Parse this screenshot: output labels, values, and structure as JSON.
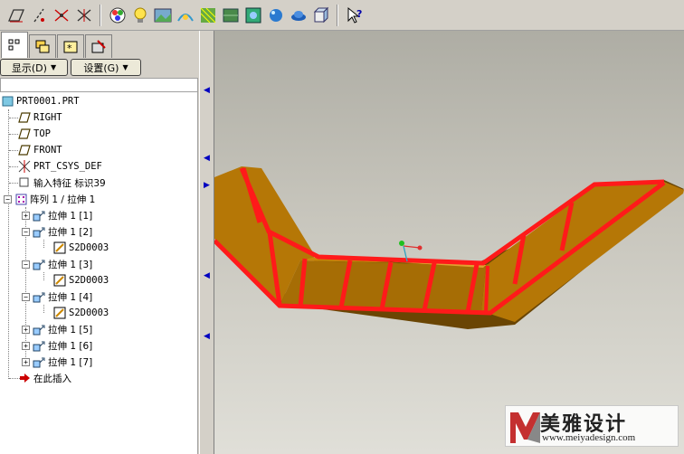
{
  "toolbar": {
    "buttons": [
      "sketch-plane-icon",
      "datum-axis-icon",
      "datum-point-icon",
      "datum-csys-icon",
      "appearance-icon",
      "light-icon",
      "scene-icon",
      "model-setup-icon",
      "texture-icon",
      "render-region-icon",
      "environment-icon",
      "sphere-icon",
      "cap-icon",
      "cube-icon",
      "whats-this-icon"
    ]
  },
  "panel": {
    "tabs": [
      "model-tree-tab",
      "layers-tab",
      "favorites-tab",
      "tools-tab"
    ],
    "show_label": "显示(D)",
    "settings_label": "设置(G)"
  },
  "tree": {
    "root": "PRT0001.PRT",
    "right": "RIGHT",
    "top": "TOP",
    "front": "FRONT",
    "csys": "PRT_CSYS_DEF",
    "import_feature": "输入特征 标识39",
    "pattern": "阵列 1 / 拉伸 1",
    "ext1": "拉伸 1 [1]",
    "ext2": "拉伸 1 [2]",
    "s2d2": "S2D0003",
    "ext3": "拉伸 1 [3]",
    "s2d3": "S2D0003",
    "ext4": "拉伸 1 [4]",
    "s2d4": "S2D0003",
    "ext5": "拉伸 1 [5]",
    "ext6": "拉伸 1 [6]",
    "ext7": "拉伸 1 [7]",
    "insert_here": "在此插入"
  },
  "watermark": {
    "brand": "美雅设计",
    "url": "www.meiyadesign.com"
  },
  "colors": {
    "part": "#c8860a",
    "part_dark": "#8a5a05",
    "edge": "#ff1a1a",
    "viewport_top": "#aeada4",
    "viewport_bottom": "#e0dfd8"
  }
}
